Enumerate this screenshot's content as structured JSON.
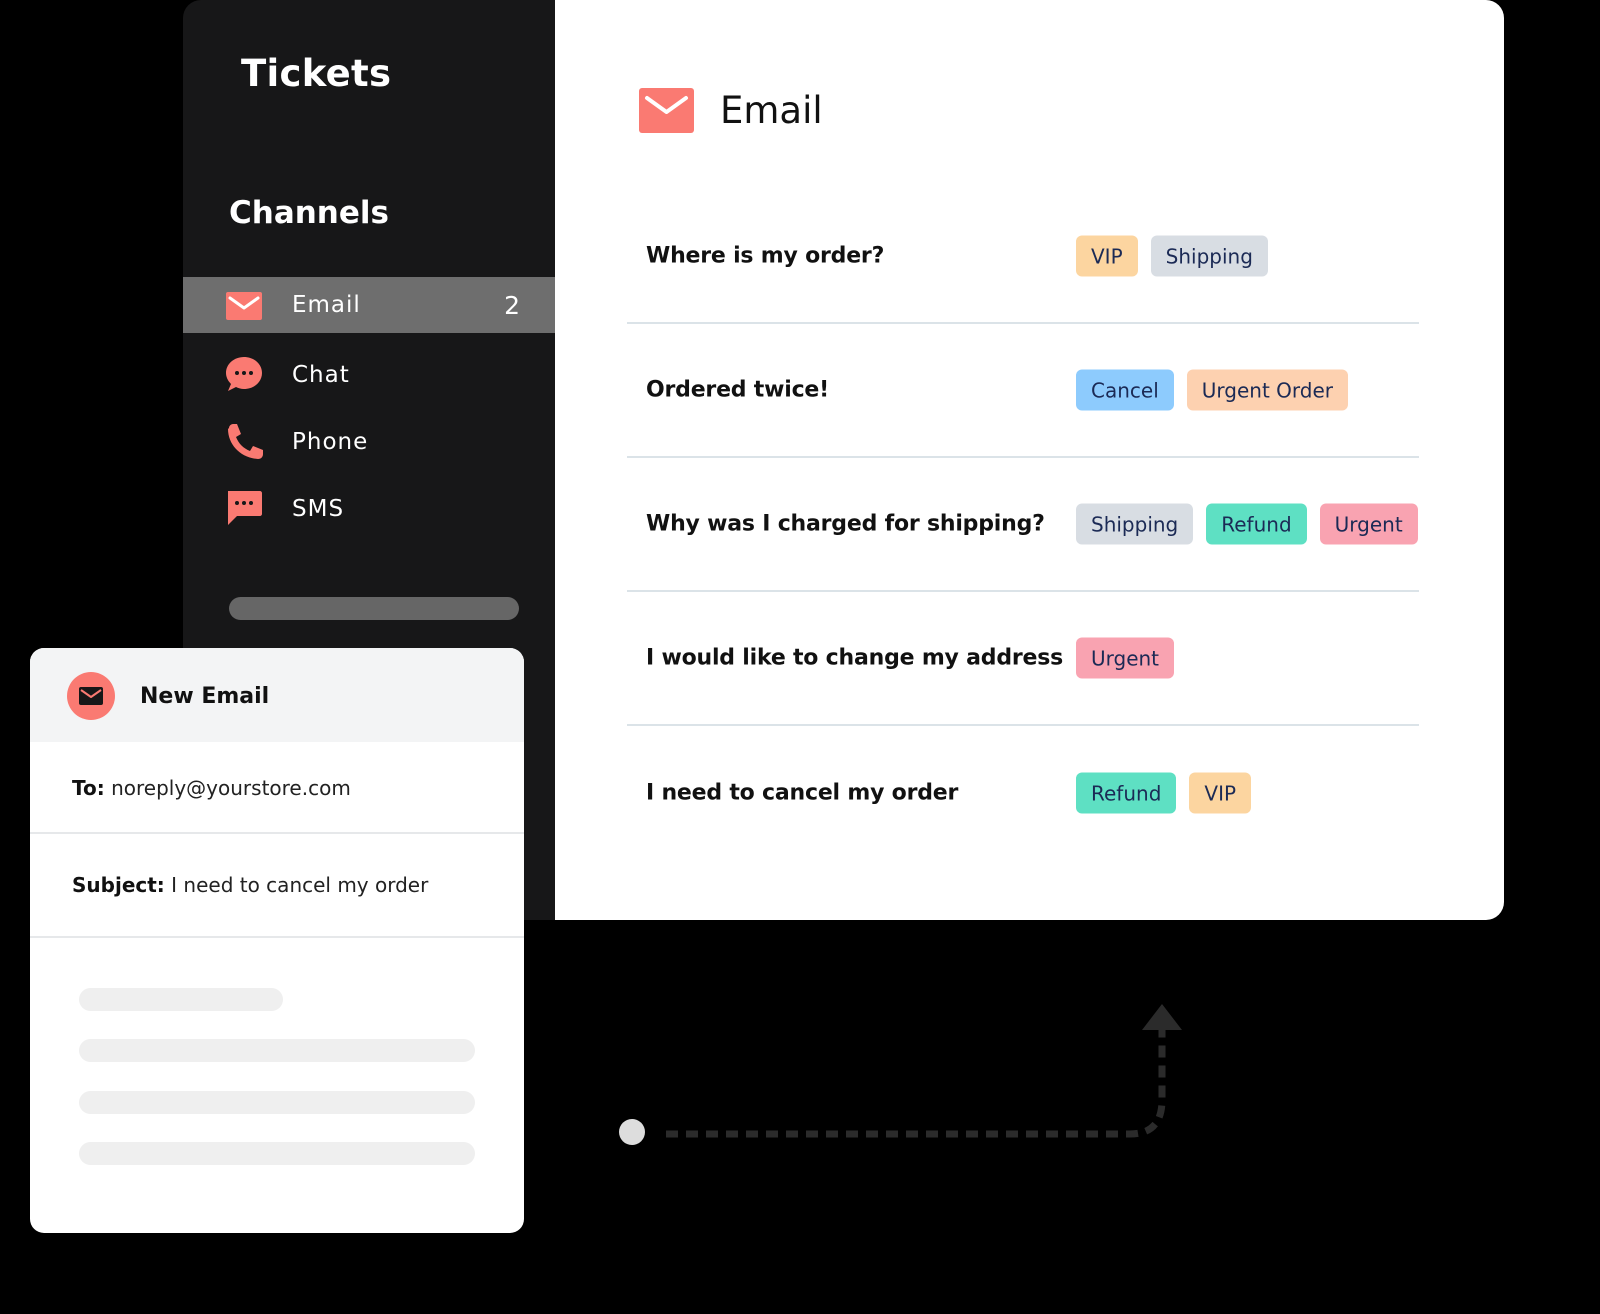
{
  "sidebar": {
    "title": "Tickets",
    "section_label": "Channels",
    "channels": [
      {
        "label": "Email",
        "icon": "envelope-icon",
        "count": "2",
        "active": true
      },
      {
        "label": "Chat",
        "icon": "chat-bubble-icon",
        "active": false
      },
      {
        "label": "Phone",
        "icon": "phone-icon",
        "active": false
      },
      {
        "label": "SMS",
        "icon": "sms-bubble-icon",
        "active": false
      }
    ]
  },
  "main": {
    "title": "Email",
    "icon": "envelope-icon",
    "tickets": [
      {
        "subject": "Where is my order?",
        "tags": [
          "VIP",
          "Shipping"
        ]
      },
      {
        "subject": "Ordered twice!",
        "tags": [
          "Cancel",
          "Urgent Order"
        ]
      },
      {
        "subject": "Why was I charged for shipping?",
        "tags": [
          "Shipping",
          "Refund",
          "Urgent"
        ]
      },
      {
        "subject": "I would like to change my address",
        "tags": [
          "Urgent"
        ]
      },
      {
        "subject": "I need to cancel my order",
        "tags": [
          "Refund",
          "VIP"
        ]
      }
    ]
  },
  "tag_colors": {
    "VIP": "#fcd5a0",
    "Shipping": "#d8dde3",
    "Cancel": "#8dcbfd",
    "Urgent Order": "#fdd1b0",
    "Refund": "#5ee0c3",
    "Urgent": "#f9a3b1"
  },
  "new_email": {
    "title": "New Email",
    "to_label": "To:",
    "to_value": "noreply@yourstore.com",
    "subject_label": "Subject:",
    "subject_value": "I need to cancel my order"
  },
  "colors": {
    "accent": "#fa7a72",
    "sidebar_bg": "#171718",
    "active_item_bg": "#6e6e6e",
    "tag_text": "#1b2a55"
  }
}
